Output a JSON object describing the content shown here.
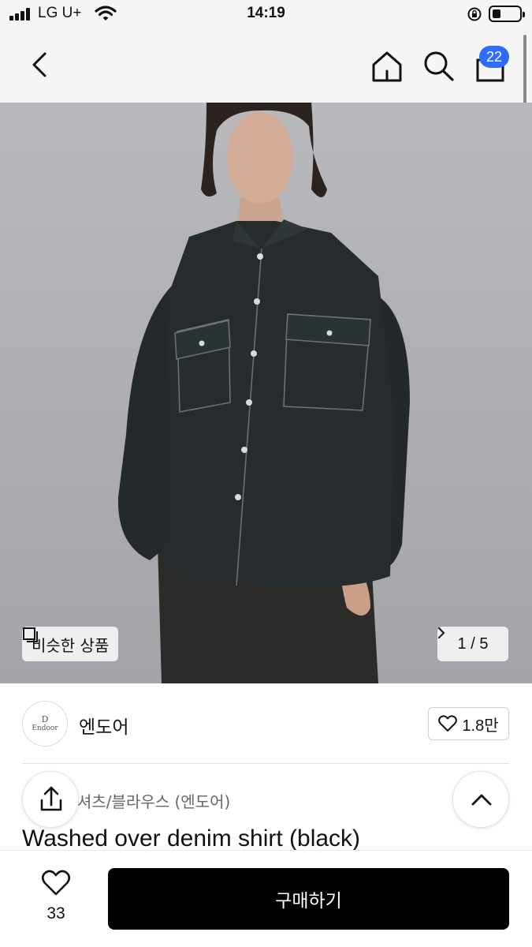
{
  "status_bar": {
    "carrier": "LG U+",
    "time": "14:19"
  },
  "nav": {
    "cart_count": "22",
    "icons": [
      "chevron-left-icon",
      "home-icon",
      "search-icon",
      "shopping-bag-icon"
    ]
  },
  "gallery": {
    "similar_label": "비슷한 상품",
    "counter": "1 / 5"
  },
  "brand": {
    "logo_text_1": "D",
    "logo_text_2": "Endoor",
    "name": "엔도어",
    "likes": "1.8만"
  },
  "product": {
    "category": "셔츠/블라우스 (엔도어)",
    "title": "Washed over denim shirt (black)"
  },
  "bottom": {
    "wish_count": "33",
    "buy_label": "구매하기"
  },
  "colors": {
    "accent": "#2f6bff",
    "buy_button": "#000000"
  }
}
